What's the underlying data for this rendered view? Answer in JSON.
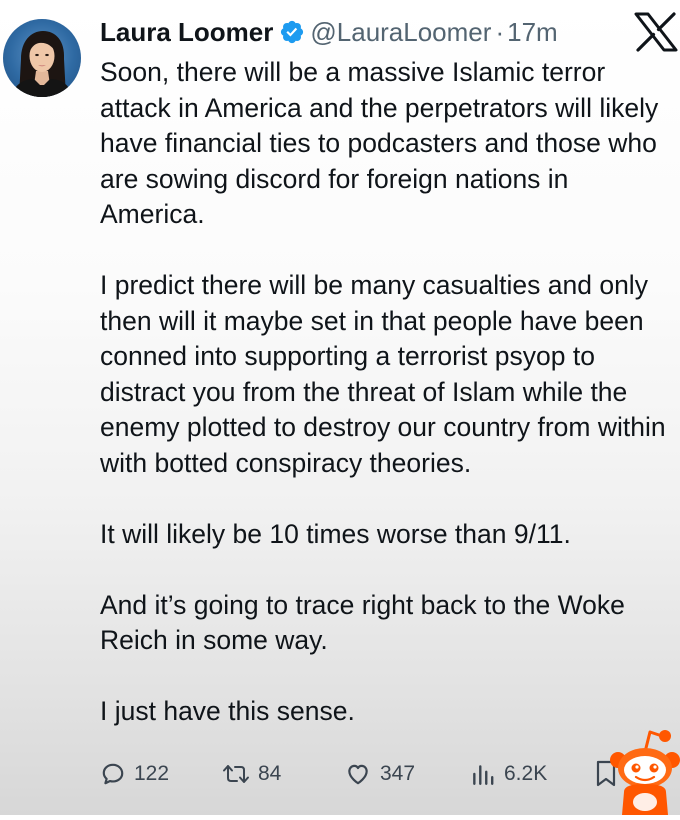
{
  "author": {
    "display_name": "Laura Loomer",
    "handle": "@LauraLoomer",
    "separator": "·",
    "time_ago": "17m",
    "verified": true,
    "verified_color": "#1d9bf0",
    "avatar_icon": "profile-photo"
  },
  "platform_logo": "x-logo",
  "tweet": {
    "paragraphs": [
      "Soon, there will be a massive Islamic terror attack in America and the perpetrators will likely have financial ties to podcasters and those who are sowing discord for foreign nations in America.",
      "I predict there will be many casualties and only then will it maybe set in that people have been conned into supporting a terrorist psyop to distract you from the threat of Islam while the enemy plotted to destroy our country from within with botted conspiracy theories.",
      "It will likely be 10 times worse than 9/11.",
      "And it’s going to trace right back to the Woke Reich in some way.",
      "I just have this sense."
    ]
  },
  "actions": {
    "replies": {
      "icon": "reply-icon",
      "count": "122"
    },
    "reposts": {
      "icon": "repost-icon",
      "count": "84"
    },
    "likes": {
      "icon": "like-icon",
      "count": "347"
    },
    "views": {
      "icon": "views-icon",
      "count": "6.2K"
    },
    "bookmark": {
      "icon": "bookmark-icon"
    }
  },
  "overlay": {
    "watermark": "reddit-snoo-mascot",
    "watermark_color": "#ff5700"
  }
}
